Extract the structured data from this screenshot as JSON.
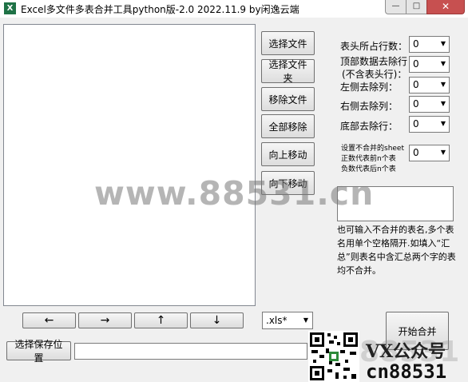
{
  "window": {
    "app_icon": "X",
    "title": "Excel多文件多表合并工具python版-2.0 2022.11.9 by闲逸云端",
    "minimize": "—",
    "maximize": "□",
    "close": "✕"
  },
  "side_buttons": {
    "select_file": "选择文件",
    "select_folder": "选择文件夹",
    "remove_file": "移除文件",
    "remove_all": "全部移除",
    "move_up": "向上移动",
    "move_down": "向下移动"
  },
  "settings": {
    "header_rows_label": "表头所占行数：",
    "header_rows_value": "0",
    "top_rows_label_1": "顶部数据去除行",
    "top_rows_label_2": "(不含表头行)：",
    "top_rows_value": "0",
    "left_cols_label": "左侧去除列：",
    "left_cols_value": "0",
    "right_cols_label": "右侧去除列：",
    "right_cols_value": "0",
    "bottom_rows_label": "底部去除行：",
    "bottom_rows_value": "0",
    "skip_sheet_label_1": "设置不合并的sheet",
    "skip_sheet_label_2": "正数代表前n个表",
    "skip_sheet_label_3": "负数代表后n个表",
    "skip_sheet_value": "0"
  },
  "note": "也可输入不合并的表名,多个表名用单个空格隔开.如填入“汇总”则表名中含汇总两个字的表均不合并。",
  "arrows": {
    "left": "←",
    "right": "→",
    "up": "↑",
    "down": "↓"
  },
  "ext_combo_value": ".xls*",
  "start_button": "开始合并",
  "save_button": "选择保存位置",
  "watermark": "www.88531.cn",
  "watermark_bottom": "88531",
  "vx_text": "VX公众号",
  "cn_text": "cn88531",
  "icons": {
    "app": "excel-icon",
    "dropdown": "chevron-down-icon",
    "qr": "qr-code-icon"
  }
}
